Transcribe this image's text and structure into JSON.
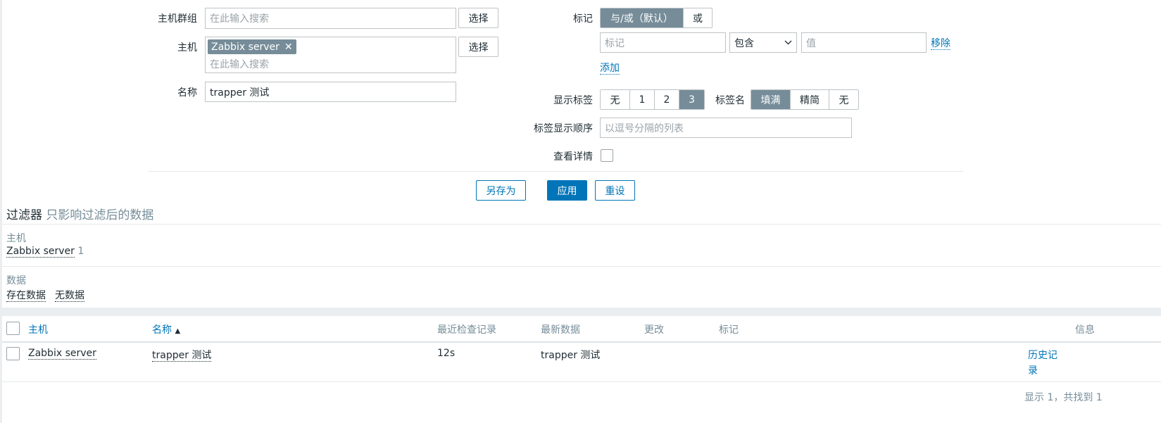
{
  "filter": {
    "host_groups_label": "主机群组",
    "host_groups_placeholder": "在此输入搜索",
    "select_label": "选择",
    "hosts_label": "主机",
    "host_chip": "Zabbix server",
    "hosts_placeholder": "在此输入搜索",
    "name_label": "名称",
    "name_value": "trapper 测试",
    "tags_label": "标记",
    "tags_mode": [
      "与/或（默认）",
      "或"
    ],
    "tag_placeholder": "标记",
    "tag_operator": "包含",
    "value_placeholder": "值",
    "remove_label": "移除",
    "add_label": "添加",
    "show_tags_label": "显示标签",
    "show_tags_options": [
      "无",
      "1",
      "2",
      "3"
    ],
    "tag_name_label": "标签名",
    "tag_name_options": [
      "填满",
      "精简",
      "无"
    ],
    "tag_order_label": "标签显示顺序",
    "tag_order_placeholder": "以逗号分隔的列表",
    "show_details_label": "查看详情",
    "save_as": "另存为",
    "apply": "应用",
    "reset": "重设"
  },
  "subfilter": {
    "title": "过滤器",
    "subtitle": "只影响过滤后的数据",
    "hosts_heading": "主机",
    "host_item": "Zabbix server",
    "host_count": "1",
    "data_heading": "数据",
    "data_with": "存在数据",
    "data_without": "无数据"
  },
  "table": {
    "columns": {
      "host": "主机",
      "name": "名称",
      "last_check": "最近检查记录",
      "last_value": "最新数据",
      "change": "更改",
      "tags": "标记",
      "info": "信息"
    },
    "rows": [
      {
        "host": "Zabbix server",
        "name": "trapper 测试",
        "last_check": "12s",
        "last_value": "trapper 测试",
        "history_1": "历史记",
        "history_2": "录"
      }
    ],
    "footer": "显示 1，共找到 1"
  },
  "colors": {
    "accent": "#0275b8",
    "segment_active": "#768d99"
  }
}
